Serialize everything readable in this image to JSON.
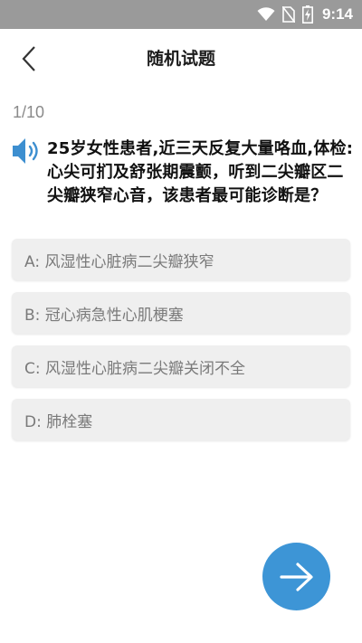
{
  "status_bar": {
    "time": "9:14",
    "icons": [
      "wifi-icon",
      "no-sim-icon",
      "battery-charging-icon"
    ]
  },
  "header": {
    "title": "随机试题",
    "back_icon": "chevron-left-icon"
  },
  "quiz": {
    "progress": "1/10",
    "speaker_icon": "speaker-icon",
    "question": "25岁女性患者,近三天反复大量咯血,体检:心尖可扪及舒张期震颤，听到二尖瓣区二尖瓣狭窄心音，该患者最可能诊断是？",
    "options": [
      {
        "label": "A: 风湿性心脏病二尖瓣狭窄"
      },
      {
        "label": "B: 冠心病急性心肌梗塞"
      },
      {
        "label": "C: 风湿性心脏病二尖瓣关闭不全"
      },
      {
        "label": "D: 肺栓塞"
      }
    ]
  },
  "next_button": {
    "icon": "arrow-right-icon",
    "color": "#3d95d6"
  },
  "colors": {
    "status_bar": "#9a9a9a",
    "accent": "#3d95d6",
    "option_bg": "#efefef"
  }
}
